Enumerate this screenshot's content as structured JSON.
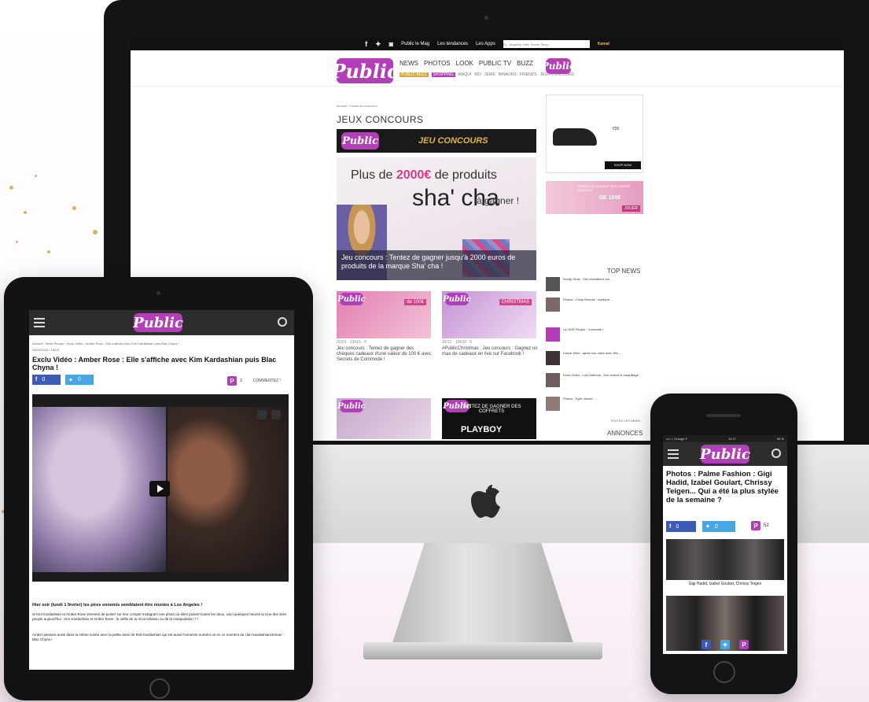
{
  "colors": {
    "brand": "#b23fb7",
    "facebook": "#3b5bb5",
    "twitter": "#49a6e5",
    "gold": "#d8a93b"
  },
  "desktop": {
    "topbar": {
      "icons": [
        "facebook-icon",
        "twitter-icon",
        "instagram-icon"
      ],
      "links": [
        "Public le Mag",
        "Les tendances",
        "Les Apps"
      ],
      "search_placeholder": "Ex : Angelina Jolie, Secret Story...",
      "promo": "Kamal"
    },
    "logo": "Public",
    "nav": [
      "NEWS",
      "PHOTOS",
      "LOOK",
      "PUBLIC TV",
      "BUZZ"
    ],
    "subnav": [
      "PUBLIC BUZZ",
      "SHOPPING",
      "MAQUI",
      "BIO",
      "JEWE",
      "BINAVINS",
      "FRIENDS",
      "JEUX CONCOURS"
    ],
    "breadcrumb": "Accueil › Toutes les concours",
    "section_title": "JEUX CONCOURS",
    "banner": {
      "logo": "Public",
      "text": "JEU CONCOURS"
    },
    "hero": {
      "title_pre": "Plus de ",
      "amount": "2000€",
      "title_post": " de produits",
      "brand": "sha' cha",
      "tagline": "à gagner !",
      "caption": "Jeu concours : Tentez de gagner jusqu'à 2000 euros de produits de la marque Sha' cha !"
    },
    "cards": [
      {
        "logo": "Public",
        "tag": "de 100€",
        "meta": "02/01 · 12h15 · 8",
        "text": "Jeu concours : Tentez de gagner des chèques cadeaux d'une valeur de 100 € avec Secrets de Commode !"
      },
      {
        "logo": "Public",
        "tag": "CHRISTMAS",
        "meta": "15/12 · 10h30 · 6",
        "text": "#PublicChristmas : Jeu concours : Gagnez un max de cadeaux en live sur Facebook !"
      },
      {
        "logo": "Public",
        "tag": "",
        "meta": "",
        "text": ""
      },
      {
        "logo": "Public",
        "heading": "TENTEZ DE GAGNER DES COFFRETS",
        "big": "PLAYBOY"
      }
    ],
    "sidebar": {
      "ad_price": "€55",
      "ad_button": "SHOP NOW",
      "pink_ad": {
        "label": "TENTEZ DE GAGNER DES CARTES CADEAUX",
        "amount": "DE 100€",
        "cta": "JOUER"
      },
      "top_news_title": "TOP NEWS",
      "top_news": [
        "Kendji Girac : Ses révélations sur ...",
        "Photos : Cindy Bemdal : explique ...",
        "La VIDÉ People : Corinaute !",
        "Kanye West : après son clash avec Wiz ...",
        "Exclu Vidéo : Lolo Vallence : Eve enlève le maquillage ...",
        "Photos : Kylie Jenner : ..."
      ],
      "all_news": "TOUTES LES NEWS",
      "annonces": "ANNONCES"
    }
  },
  "tablet": {
    "logo": "Public",
    "breadcrumb": "Accueil › News People › Exclu Vidéo : Amber Rose : Elle s'affiche avec Kim Kardashian puis Blac Chyna !",
    "date": "02/02/2016 • 18h21",
    "title": "Exclu Vidéo : Amber Rose : Elle s'affiche avec Kim Kardashian puis Blac Chyna !",
    "facebook_count": "0",
    "twitter_count": "0",
    "comments_count": "3",
    "comments_label": "COMMENTEZ !",
    "lead": "Hier soir (lundi 1 février) les pires ennemis semblaient être réunies à Los Angeles !",
    "paragraph1": "Si Kim Kardashian et Amber Rose viennent de poster sur leur compte Instagram une photo où elles posent toutes les deux, voici quelques heures la Une des sites people aujourd'hui : Kim Kardashian et Amber Rose : le selfie de la réconciliation ou de la manipulation ? !",
    "paragraph2": "Amber passera aussi dans la même soirée avec la petite amie de Rob Kardashian qui est aussi l'ennemie numéro un en ce moment du clan Kardashian/Jenner : Blac Chyna !"
  },
  "phone": {
    "status": {
      "carrier": "•••○○ Orange F",
      "time": "11:17",
      "battery": "35 %"
    },
    "logo": "Public",
    "title": "Photos : Palme Fashion : Gigi Hadid, Izabel Goulart, Chrissy Teigen... Qui a été la plus stylée de la semaine ?",
    "facebook_count": "0",
    "twitter_count": "0",
    "comments_count": "52",
    "caption": "Gigi Hadid, Izabel Goulart, Chrissy Teigen"
  }
}
